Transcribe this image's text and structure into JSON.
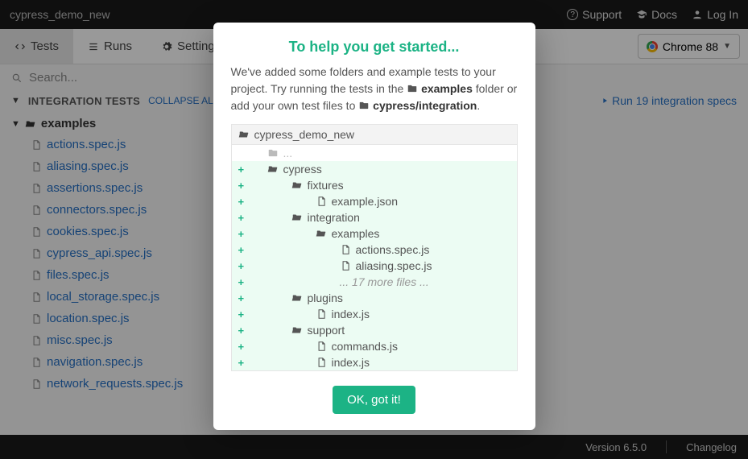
{
  "titlebar": {
    "project": "cypress_demo_new",
    "support": "Support",
    "docs": "Docs",
    "login": "Log In"
  },
  "toolbar": {
    "tests": "Tests",
    "runs": "Runs",
    "settings": "Settings",
    "browser": "Chrome 88"
  },
  "search": {
    "placeholder": "Search..."
  },
  "tests_header": {
    "title": "INTEGRATION TESTS",
    "collapse": "COLLAPSE ALL",
    "run_link": "Run 19 integration specs"
  },
  "tree": {
    "folder": "examples",
    "files": [
      "actions.spec.js",
      "aliasing.spec.js",
      "assertions.spec.js",
      "connectors.spec.js",
      "cookies.spec.js",
      "cypress_api.spec.js",
      "files.spec.js",
      "local_storage.spec.js",
      "location.spec.js",
      "misc.spec.js",
      "navigation.spec.js",
      "network_requests.spec.js"
    ]
  },
  "footer": {
    "version": "Version 6.5.0",
    "changelog": "Changelog"
  },
  "modal": {
    "title": "To help you get started...",
    "intro_1": "We've added some folders and example tests to your project. Try running the tests in the ",
    "folder_icon": "📁",
    "examples_b": "examples",
    "intro_2": " folder or add your own test files to ",
    "integration_b": "cypress/integration",
    "project_name": "cypress_demo_new",
    "ellipsis": "...",
    "items": [
      {
        "indent": 0,
        "type": "folder-open",
        "name": "cypress"
      },
      {
        "indent": 1,
        "type": "folder-open",
        "name": "fixtures"
      },
      {
        "indent": 2,
        "type": "file",
        "name": "example.json"
      },
      {
        "indent": 1,
        "type": "folder-open",
        "name": "integration"
      },
      {
        "indent": 2,
        "type": "folder-open",
        "name": "examples"
      },
      {
        "indent": 3,
        "type": "file",
        "name": "actions.spec.js"
      },
      {
        "indent": 3,
        "type": "file",
        "name": "aliasing.spec.js"
      },
      {
        "indent": 3,
        "type": "more",
        "name": "... 17 more files ..."
      },
      {
        "indent": 1,
        "type": "folder-open",
        "name": "plugins"
      },
      {
        "indent": 2,
        "type": "file",
        "name": "index.js"
      },
      {
        "indent": 1,
        "type": "folder-open",
        "name": "support"
      },
      {
        "indent": 2,
        "type": "file",
        "name": "commands.js"
      },
      {
        "indent": 2,
        "type": "file",
        "name": "index.js"
      }
    ],
    "ok": "OK, got it!"
  }
}
